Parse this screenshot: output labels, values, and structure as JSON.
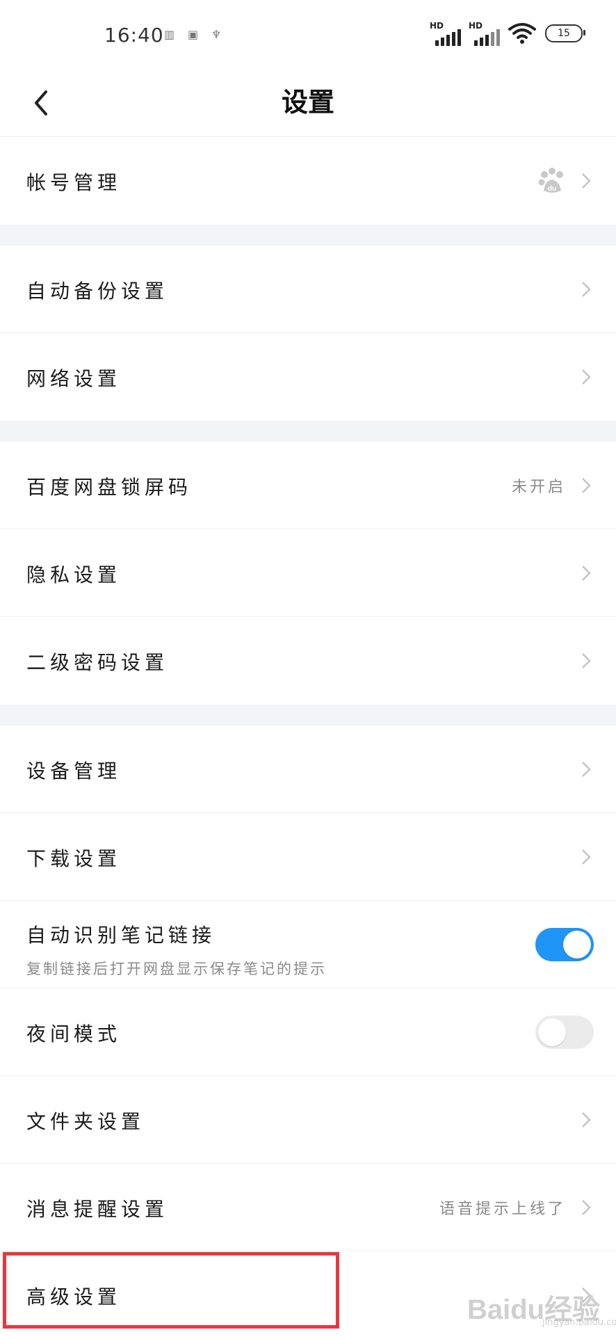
{
  "status_bar": {
    "time": "16:40",
    "battery": "15",
    "network_label_1": "HD",
    "network_label_2": "HD"
  },
  "header": {
    "title": "设置"
  },
  "settings": {
    "account": {
      "label": "帐号管理",
      "icon": "baidu-paw-icon"
    },
    "auto_backup": {
      "label": "自动备份设置"
    },
    "network": {
      "label": "网络设置"
    },
    "lock_code": {
      "label": "百度网盘锁屏码",
      "value": "未开启"
    },
    "privacy": {
      "label": "隐私设置"
    },
    "secondary_password": {
      "label": "二级密码设置"
    },
    "device": {
      "label": "设备管理"
    },
    "download": {
      "label": "下载设置"
    },
    "auto_note_link": {
      "label": "自动识别笔记链接",
      "sublabel": "复制链接后打开网盘显示保存笔记的提示",
      "enabled": true
    },
    "night_mode": {
      "label": "夜间模式",
      "enabled": false
    },
    "folder": {
      "label": "文件夹设置"
    },
    "notification": {
      "label": "消息提醒设置",
      "value": "语音提示上线了"
    },
    "advanced": {
      "label": "高级设置"
    }
  },
  "colors": {
    "accent": "#1e95f7",
    "highlight_box": "#e8383d",
    "section_gap": "#f3f4f8"
  },
  "watermark": {
    "text": "Baidu经验",
    "url_text": "jingyan.baidu.com"
  }
}
